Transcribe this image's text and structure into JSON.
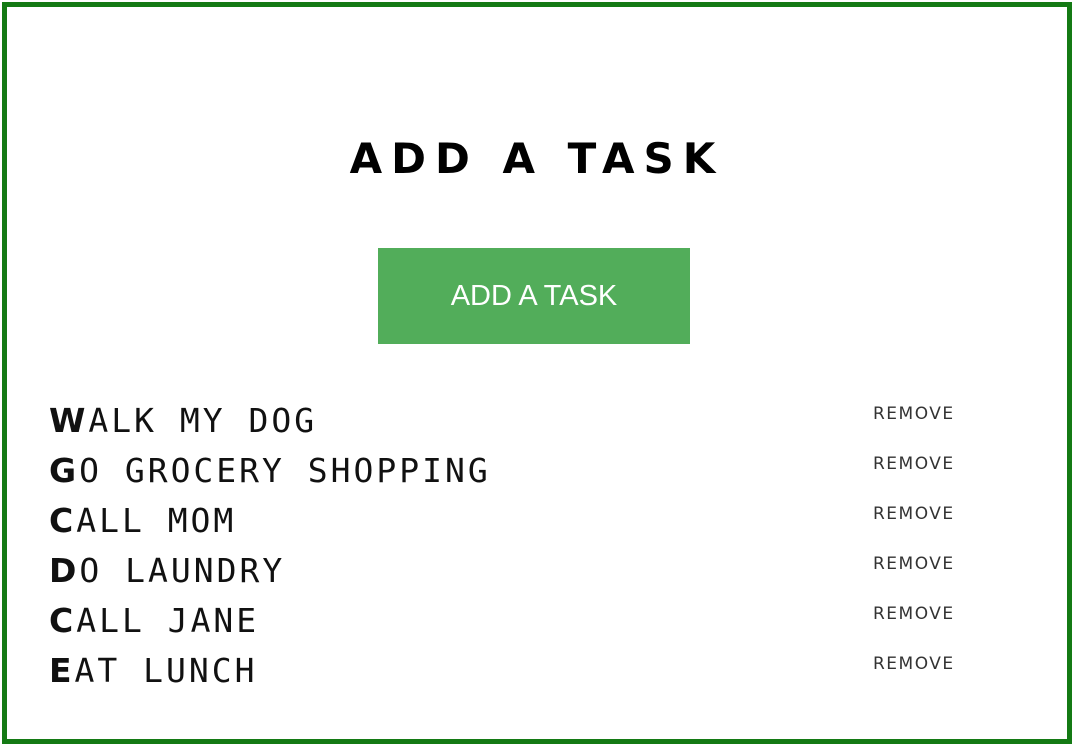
{
  "header": {
    "title": "ADD A TASK"
  },
  "add_button": {
    "label": "ADD A TASK"
  },
  "tasks": [
    {
      "first": "W",
      "rest": "ALK MY DOG",
      "remove_label": "REMOVE"
    },
    {
      "first": "G",
      "rest": "O GROCERY SHOPPING",
      "remove_label": "REMOVE"
    },
    {
      "first": "C",
      "rest": "ALL MOM",
      "remove_label": "REMOVE"
    },
    {
      "first": "D",
      "rest": "O LAUNDRY",
      "remove_label": "REMOVE"
    },
    {
      "first": "C",
      "rest": "ALL J",
      "mid": "ANE",
      "mid_cap": "J",
      "remove_label": "REMOVE"
    },
    {
      "first": "E",
      "rest": "AT LUNCH",
      "remove_label": "REMOVE"
    }
  ],
  "colors": {
    "frame_border": "#147a14",
    "button_bg": "#52ad5a",
    "button_text": "#ffffff"
  }
}
